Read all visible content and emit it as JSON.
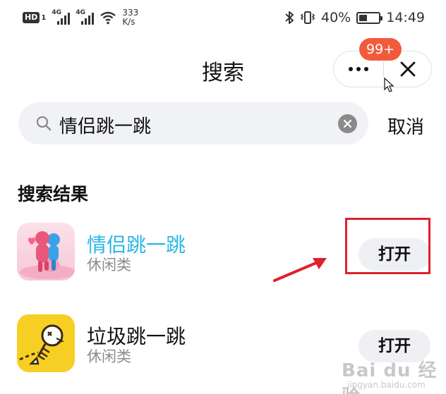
{
  "status_bar": {
    "hd": "HD",
    "hd_sub": "1",
    "sim1_type": "4G",
    "sim2_type": "4G",
    "speed_value": "333",
    "speed_unit": "K/s",
    "battery_percent": "40%",
    "battery_level": 0.4,
    "time": "14:49"
  },
  "header": {
    "title": "搜索",
    "more_icon": "more-dots-icon",
    "close_icon": "close-icon",
    "notification_badge": "99+"
  },
  "search": {
    "icon": "search-icon",
    "query": "情侣跳一跳",
    "clear_icon": "clear-icon",
    "cancel_label": "取消"
  },
  "results": {
    "heading": "搜索结果",
    "items": [
      {
        "name": "情侣跳一跳",
        "category": "休闲类",
        "action": "打开",
        "name_color": "#29b6e6"
      },
      {
        "name": "垃圾跳一跳",
        "category": "休闲类",
        "action": "打开",
        "name_color": "#111111"
      }
    ]
  },
  "watermark": {
    "top": "Bai du 经验",
    "bottom": "jingyan.baidu.com"
  },
  "colors": {
    "accent_blue": "#29b6e6",
    "badge_red": "#f25a3c",
    "annotation_red": "#e0202b",
    "search_bg": "#f1f2f5"
  }
}
